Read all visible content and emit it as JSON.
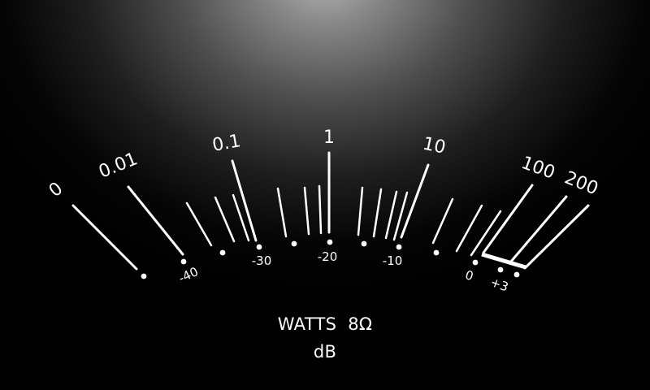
{
  "meter": {
    "units_label": "WATTS",
    "impedance_label": "8Ω",
    "db_caption": "dB",
    "colors": {
      "background_glow": "#b5b5b5",
      "background": "#000000",
      "scale": "#ffffff"
    }
  },
  "watts_scale": [
    "0",
    "0.01",
    "0.1",
    "1",
    "10",
    "100",
    "200"
  ],
  "db_scale": [
    "-40",
    "-30",
    "-20",
    "-10",
    "0",
    "+3"
  ]
}
